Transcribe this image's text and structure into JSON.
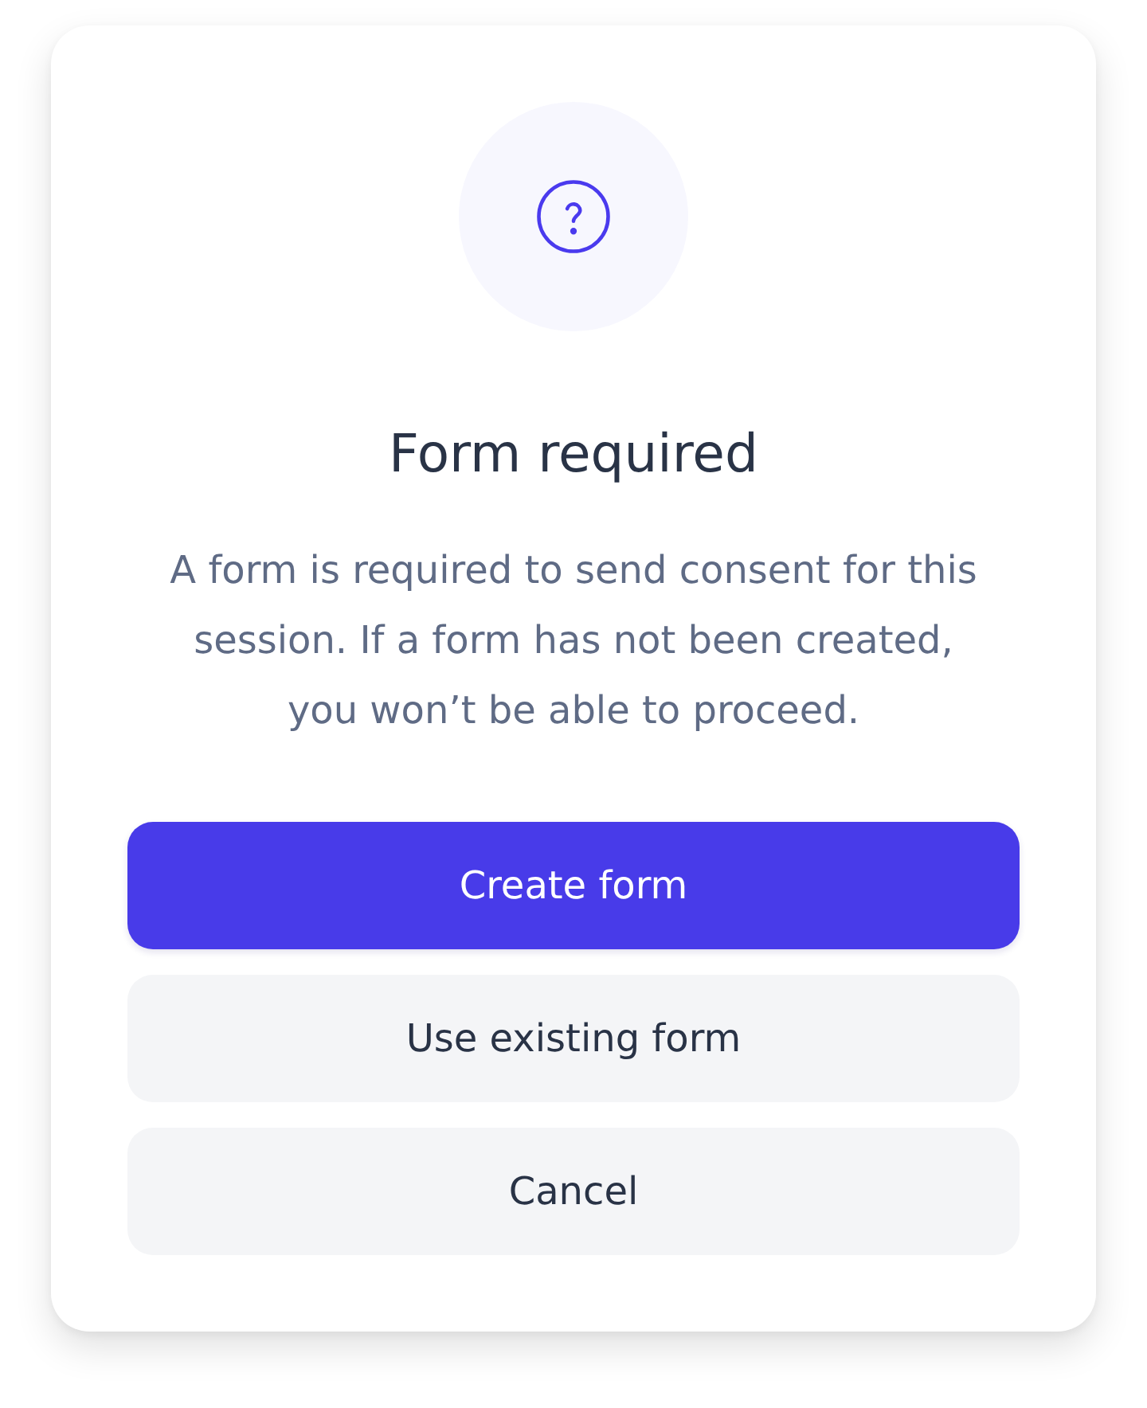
{
  "dialog": {
    "title": "Form required",
    "message": "A form is required to send consent for this session. If a form has not been created, you won’t be able to proceed.",
    "buttons": [
      {
        "label": "Create form",
        "kind": "primary"
      },
      {
        "label": "Use existing form",
        "kind": "secondary"
      },
      {
        "label": "Cancel",
        "kind": "secondary"
      }
    ]
  }
}
